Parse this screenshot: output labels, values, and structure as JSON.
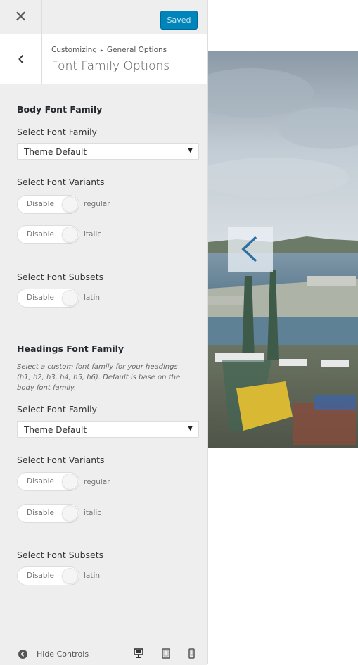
{
  "header": {
    "saved_label": "Saved"
  },
  "section": {
    "breadcrumb_root": "Customizing",
    "breadcrumb_sep": "▸",
    "breadcrumb_parent": "General Options",
    "title": "Font Family Options"
  },
  "body_font": {
    "group_title": "Body Font Family",
    "family_label": "Select Font Family",
    "family_value": "Theme Default",
    "variants_label": "Select Font Variants",
    "variant_1_state": "Disable",
    "variant_1_name": "regular",
    "variant_2_state": "Disable",
    "variant_2_name": "italic",
    "subsets_label": "Select Font Subsets",
    "subset_1_state": "Disable",
    "subset_1_name": "latin"
  },
  "heading_font": {
    "group_title": "Headings Font Family",
    "description_1": "Select a custom font family for your headings",
    "description_2": "(h1, h2, h3, h4, h5, h6). Default is base on the",
    "description_3": "body font family.",
    "family_label": "Select Font Family",
    "family_value": "Theme Default",
    "variants_label": "Select Font Variants",
    "variant_1_state": "Disable",
    "variant_1_name": "regular",
    "variant_2_state": "Disable",
    "variant_2_name": "italic",
    "subsets_label": "Select Font Subsets",
    "subset_1_state": "Disable",
    "subset_1_name": "latin"
  },
  "footer": {
    "hide_controls_label": "Hide Controls"
  },
  "icons": {
    "close": "close-icon",
    "back": "chevron-left-icon",
    "select_arrow": "triangle-down-icon",
    "hide": "circle-arrow-left-icon",
    "desktop": "desktop-icon",
    "tablet": "tablet-icon",
    "mobile": "mobile-icon",
    "slider_prev": "chevron-left-icon"
  },
  "colors": {
    "accent": "#0085ba",
    "panel_bg": "#eeeeee",
    "saved_text": "#c6e3f0"
  }
}
